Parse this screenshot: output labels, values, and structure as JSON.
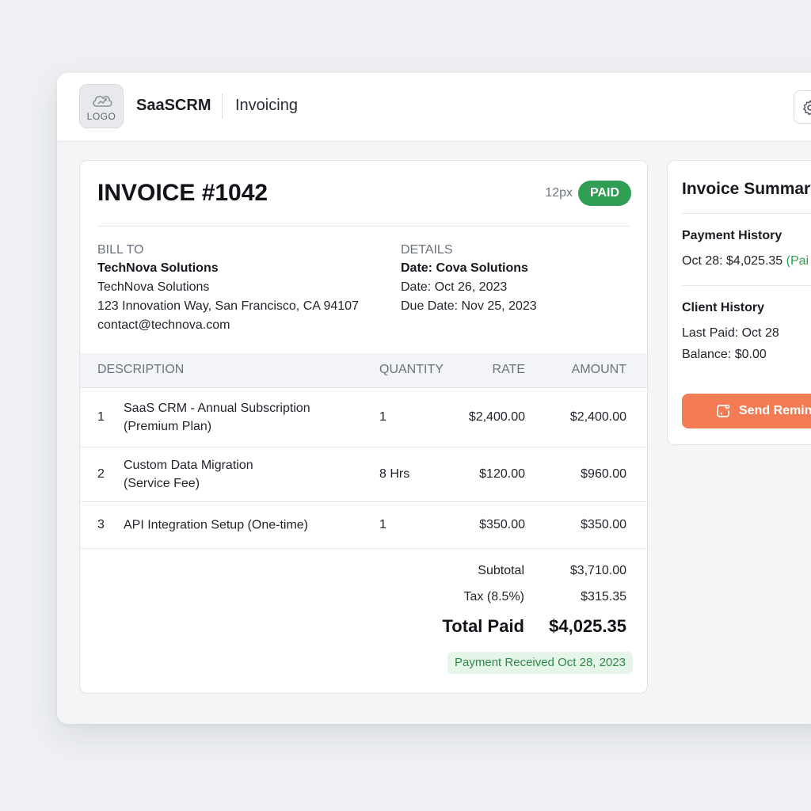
{
  "header": {
    "logo_text": "LOGO",
    "logo_icon": "cloud-chart-icon",
    "brand": "SaaSCRM",
    "section": "Invoicing",
    "settings_icon": "gear-icon"
  },
  "invoice": {
    "title": "INVOICE #1042",
    "size_note": "12px",
    "status": "PAID",
    "bill_to": {
      "label": "BILL TO",
      "name": "TechNova Solutions",
      "company": "TechNova Solutions",
      "address": "123 Innovation Way, San Francisco, CA 94107",
      "email": "contact@technova.com"
    },
    "details": {
      "label": "DETAILS",
      "line1": "Date: Cova Solutions",
      "line2": "Date: Oct 26, 2023",
      "line3": "Due Date: Nov 25, 2023"
    },
    "columns": {
      "description": "DESCRIPTION",
      "quantity": "QUANTITY",
      "rate": "RATE",
      "amount": "AMOUNT"
    },
    "items": [
      {
        "num": "1",
        "desc_line1": "SaaS CRM - Annual Subscription",
        "desc_line2": "(Premium Plan)",
        "quantity": "1",
        "rate": "$2,400.00",
        "amount": "$2,400.00"
      },
      {
        "num": "2",
        "desc_line1": "Custom Data Migration",
        "desc_line2": "(Service Fee)",
        "quantity": "8 Hrs",
        "rate": "$120.00",
        "amount": "$960.00"
      },
      {
        "num": "3",
        "desc_line1": "API Integration Setup (One-time)",
        "desc_line2": "",
        "quantity": "1",
        "rate": "$350.00",
        "amount": "$350.00"
      }
    ],
    "totals": {
      "subtotal_label": "Subtotal",
      "subtotal": "$3,710.00",
      "tax_label": "Tax (8.5%)",
      "tax": "$315.35",
      "total_label": "Total Paid",
      "total": "$4,025.35"
    },
    "payment_received": "Payment Received Oct 28, 2023"
  },
  "summary": {
    "title": "Invoice Summary",
    "payment_history_title": "Payment History",
    "payment_history_line": "Oct 28: $4,025.35 ",
    "payment_history_tag": "(Pai",
    "client_history_title": "Client History",
    "last_paid": "Last Paid: Oct 28",
    "balance": "Balance: $0.00",
    "send_reminder": "Send Remin",
    "send_reminder_icon": "bell-icon"
  },
  "colors": {
    "paid_badge": "#2f9e52",
    "payment_received_bg": "#e6f5e9",
    "send_reminder_button": "#f47c55"
  }
}
